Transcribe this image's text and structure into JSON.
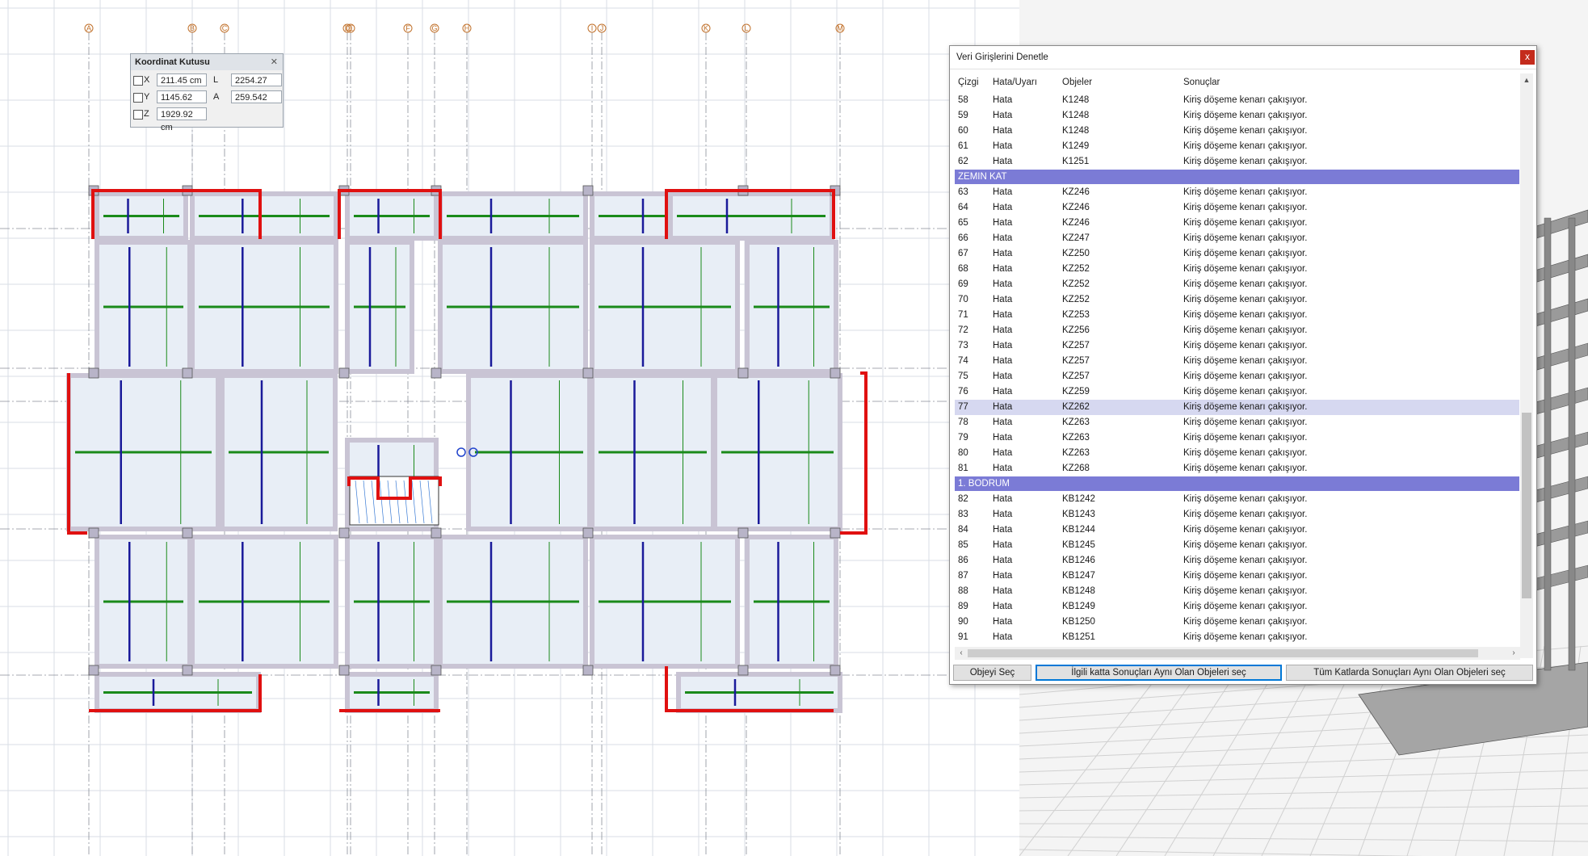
{
  "grid_labels_top": [
    "A",
    "B",
    "C",
    "D",
    "E",
    "F",
    "G",
    "H",
    "I",
    "J",
    "K",
    "L",
    "M"
  ],
  "coord_box": {
    "title": "Koordinat Kutusu",
    "close": "✕",
    "x_label": "X",
    "x_value": "211.45 cm",
    "y_label": "Y",
    "y_value": "1145.62 cm",
    "z_label": "Z",
    "z_value": "1929.92 cm",
    "l_label": "L",
    "l_value": "2254.27 cm",
    "a_label": "A",
    "a_value": "259.542"
  },
  "dialog": {
    "title": "Veri Girişlerini Denetle",
    "close": "x",
    "headers": {
      "cizgi": "Çizgi",
      "hata": "Hata/Uyarı",
      "objeler": "Objeler",
      "sonuclar": "Sonuçlar"
    },
    "rows": [
      {
        "type": "row",
        "n": "58",
        "h": "Hata",
        "o": "K1248",
        "s": "Kiriş döşeme kenarı çakışıyor."
      },
      {
        "type": "row",
        "n": "59",
        "h": "Hata",
        "o": "K1248",
        "s": "Kiriş döşeme kenarı çakışıyor."
      },
      {
        "type": "row",
        "n": "60",
        "h": "Hata",
        "o": "K1248",
        "s": "Kiriş döşeme kenarı çakışıyor."
      },
      {
        "type": "row",
        "n": "61",
        "h": "Hata",
        "o": "K1249",
        "s": "Kiriş döşeme kenarı çakışıyor."
      },
      {
        "type": "row",
        "n": "62",
        "h": "Hata",
        "o": "K1251",
        "s": "Kiriş döşeme kenarı çakışıyor."
      },
      {
        "type": "group",
        "label": "ZEMIN KAT"
      },
      {
        "type": "row",
        "n": "63",
        "h": "Hata",
        "o": "KZ246",
        "s": "Kiriş döşeme kenarı çakışıyor."
      },
      {
        "type": "row",
        "n": "64",
        "h": "Hata",
        "o": "KZ246",
        "s": "Kiriş döşeme kenarı çakışıyor."
      },
      {
        "type": "row",
        "n": "65",
        "h": "Hata",
        "o": "KZ246",
        "s": "Kiriş döşeme kenarı çakışıyor."
      },
      {
        "type": "row",
        "n": "66",
        "h": "Hata",
        "o": "KZ247",
        "s": "Kiriş döşeme kenarı çakışıyor."
      },
      {
        "type": "row",
        "n": "67",
        "h": "Hata",
        "o": "KZ250",
        "s": "Kiriş döşeme kenarı çakışıyor."
      },
      {
        "type": "row",
        "n": "68",
        "h": "Hata",
        "o": "KZ252",
        "s": "Kiriş döşeme kenarı çakışıyor."
      },
      {
        "type": "row",
        "n": "69",
        "h": "Hata",
        "o": "KZ252",
        "s": "Kiriş döşeme kenarı çakışıyor."
      },
      {
        "type": "row",
        "n": "70",
        "h": "Hata",
        "o": "KZ252",
        "s": "Kiriş döşeme kenarı çakışıyor."
      },
      {
        "type": "row",
        "n": "71",
        "h": "Hata",
        "o": "KZ253",
        "s": "Kiriş döşeme kenarı çakışıyor."
      },
      {
        "type": "row",
        "n": "72",
        "h": "Hata",
        "o": "KZ256",
        "s": "Kiriş döşeme kenarı çakışıyor."
      },
      {
        "type": "row",
        "n": "73",
        "h": "Hata",
        "o": "KZ257",
        "s": "Kiriş döşeme kenarı çakışıyor."
      },
      {
        "type": "row",
        "n": "74",
        "h": "Hata",
        "o": "KZ257",
        "s": "Kiriş döşeme kenarı çakışıyor."
      },
      {
        "type": "row",
        "n": "75",
        "h": "Hata",
        "o": "KZ257",
        "s": "Kiriş döşeme kenarı çakışıyor."
      },
      {
        "type": "row",
        "n": "76",
        "h": "Hata",
        "o": "KZ259",
        "s": "Kiriş döşeme kenarı çakışıyor."
      },
      {
        "type": "row",
        "n": "77",
        "h": "Hata",
        "o": "KZ262",
        "s": "Kiriş döşeme kenarı çakışıyor.",
        "selected": true
      },
      {
        "type": "row",
        "n": "78",
        "h": "Hata",
        "o": "KZ263",
        "s": "Kiriş döşeme kenarı çakışıyor."
      },
      {
        "type": "row",
        "n": "79",
        "h": "Hata",
        "o": "KZ263",
        "s": "Kiriş döşeme kenarı çakışıyor."
      },
      {
        "type": "row",
        "n": "80",
        "h": "Hata",
        "o": "KZ263",
        "s": "Kiriş döşeme kenarı çakışıyor."
      },
      {
        "type": "row",
        "n": "81",
        "h": "Hata",
        "o": "KZ268",
        "s": "Kiriş döşeme kenarı çakışıyor."
      },
      {
        "type": "group",
        "label": "1. BODRUM"
      },
      {
        "type": "row",
        "n": "82",
        "h": "Hata",
        "o": "KB1242",
        "s": "Kiriş döşeme kenarı çakışıyor."
      },
      {
        "type": "row",
        "n": "83",
        "h": "Hata",
        "o": "KB1243",
        "s": "Kiriş döşeme kenarı çakışıyor."
      },
      {
        "type": "row",
        "n": "84",
        "h": "Hata",
        "o": "KB1244",
        "s": "Kiriş döşeme kenarı çakışıyor."
      },
      {
        "type": "row",
        "n": "85",
        "h": "Hata",
        "o": "KB1245",
        "s": "Kiriş döşeme kenarı çakışıyor."
      },
      {
        "type": "row",
        "n": "86",
        "h": "Hata",
        "o": "KB1246",
        "s": "Kiriş döşeme kenarı çakışıyor."
      },
      {
        "type": "row",
        "n": "87",
        "h": "Hata",
        "o": "KB1247",
        "s": "Kiriş döşeme kenarı çakışıyor."
      },
      {
        "type": "row",
        "n": "88",
        "h": "Hata",
        "o": "KB1248",
        "s": "Kiriş döşeme kenarı çakışıyor."
      },
      {
        "type": "row",
        "n": "89",
        "h": "Hata",
        "o": "KB1249",
        "s": "Kiriş döşeme kenarı çakışıyor."
      },
      {
        "type": "row",
        "n": "90",
        "h": "Hata",
        "o": "KB1250",
        "s": "Kiriş döşeme kenarı çakışıyor."
      },
      {
        "type": "row",
        "n": "91",
        "h": "Hata",
        "o": "KB1251",
        "s": "Kiriş döşeme kenarı çakışıyor."
      }
    ],
    "buttons": {
      "select_object": "Objeyi Seç",
      "select_same_floor": "İlgili katta Sonuçları Aynı Olan Objeleri seç",
      "select_all_floors": "Tüm Katlarda Sonuçları Aynı Olan Objeleri seç"
    }
  },
  "colors": {
    "slab_fill": "#e8eef6",
    "beam_gray": "#c9c4d4",
    "error_red": "#e01010",
    "rebar_green": "#1a8a1a",
    "rebar_blue": "#1a1a9a",
    "group_header": "#7b7bd6",
    "selected_row": "#d6d8f0",
    "grid_line": "#d8dde6",
    "axis_orange": "#c0702a"
  }
}
